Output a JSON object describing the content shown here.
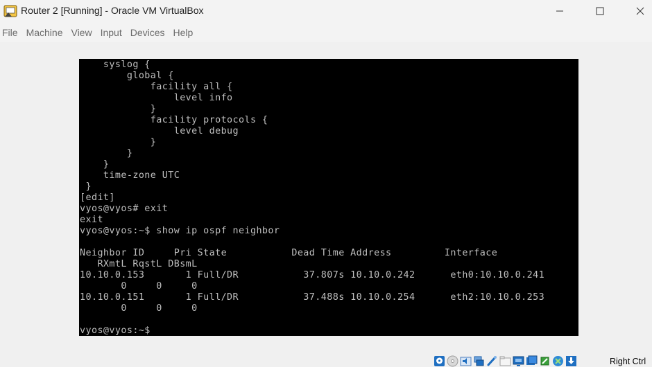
{
  "window": {
    "title": "Router 2 [Running] - Oracle VM VirtualBox"
  },
  "menu": {
    "items": [
      "File",
      "Machine",
      "View",
      "Input",
      "Devices",
      "Help"
    ]
  },
  "console": {
    "lines": [
      "    syslog {",
      "        global {",
      "            facility all {",
      "                level info",
      "            }",
      "            facility protocols {",
      "                level debug",
      "            }",
      "        }",
      "    }",
      "    time-zone UTC",
      " }",
      "[edit]",
      "vyos@vyos# exit",
      "exit",
      "vyos@vyos:~$ show ip ospf neighbor",
      "",
      "Neighbor ID     Pri State           Dead Time Address         Interface",
      "   RXmtL RqstL DBsmL",
      "10.10.0.153       1 Full/DR           37.807s 10.10.0.242      eth0:10.10.0.241",
      "       0     0     0",
      "10.10.0.151       1 Full/DR           37.488s 10.10.0.254      eth2:10.10.0.253",
      "       0     0     0",
      "",
      "vyos@vyos:~$"
    ]
  },
  "statusbar": {
    "icons": [
      "hard-disk-icon",
      "optical-drive-icon",
      "audio-icon",
      "network-icon",
      "usb-icon",
      "shared-folders-icon",
      "display-icon",
      "recording-icon",
      "cpu-icon",
      "mouse-integration-icon",
      "keyboard-arrow-icon"
    ],
    "host_key": "Right Ctrl"
  }
}
